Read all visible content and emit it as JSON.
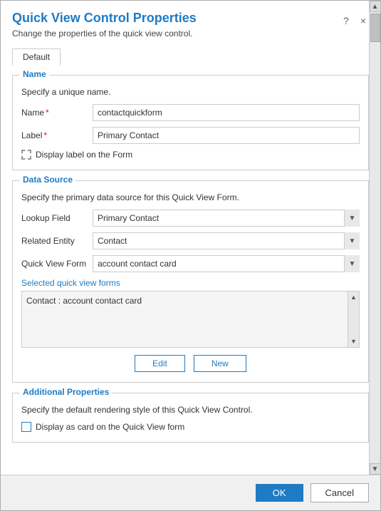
{
  "dialog": {
    "title": "Quick View Control Properties",
    "subtitle": "Change the properties of the quick view control.",
    "help_icon": "?",
    "close_icon": "×"
  },
  "tabs": [
    {
      "label": "Default",
      "active": true
    }
  ],
  "name_section": {
    "legend": "Name",
    "description": "Specify a unique name.",
    "name_label": "Name",
    "name_required": "*",
    "name_value": "contactquickform",
    "label_label": "Label",
    "label_required": "*",
    "label_value": "Primary Contact",
    "display_label_text": "Display label on the Form"
  },
  "data_source_section": {
    "legend": "Data Source",
    "description": "Specify the primary data source for this Quick View Form.",
    "lookup_field_label": "Lookup Field",
    "lookup_field_value": "Primary Contact",
    "related_entity_label": "Related Entity",
    "related_entity_value": "Contact",
    "quick_view_form_label": "Quick View Form",
    "quick_view_form_value": "account contact card",
    "selected_forms_label": "Selected quick view forms",
    "selected_forms_items": [
      "Contact : account contact card"
    ],
    "edit_button_label": "Edit",
    "new_button_label": "New",
    "lookup_options": [
      "Primary Contact"
    ],
    "related_entity_options": [
      "Contact"
    ],
    "quick_view_form_options": [
      "account contact card"
    ]
  },
  "additional_section": {
    "legend": "Additional Properties",
    "description": "Specify the default rendering style of this Quick View Control.",
    "checkbox_label": "Display as card on the Quick View form"
  },
  "footer": {
    "ok_label": "OK",
    "cancel_label": "Cancel"
  }
}
